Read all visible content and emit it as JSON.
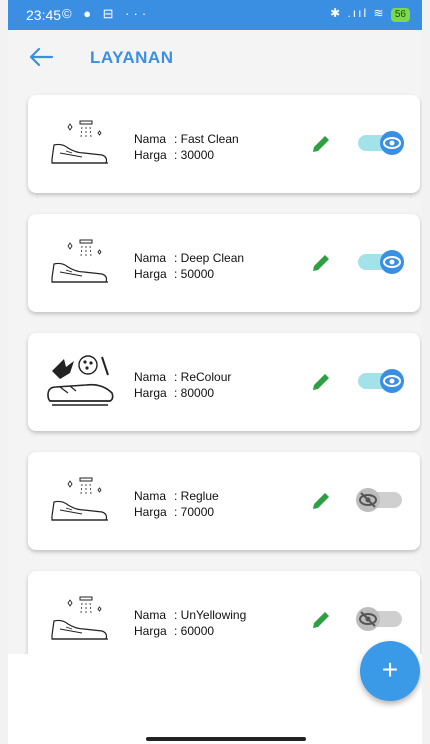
{
  "status_bar": {
    "time": "23:45",
    "left_icons": "© ● ⊟ ···",
    "right_icons": "✱ .ııl ≋",
    "battery": "56"
  },
  "header": {
    "title": "LAYANAN"
  },
  "labels": {
    "name": "Nama",
    "price": "Harga"
  },
  "services": [
    {
      "name": "Fast Clean",
      "price": "30000",
      "visible": true,
      "icon": "shoe-cleaning-icon"
    },
    {
      "name": "Deep Clean",
      "price": "50000",
      "visible": true,
      "icon": "shoe-cleaning-icon"
    },
    {
      "name": "ReColour",
      "price": "80000",
      "visible": true,
      "icon": "shoe-painting-icon"
    },
    {
      "name": "Reglue",
      "price": "70000",
      "visible": false,
      "icon": "shoe-cleaning-icon"
    },
    {
      "name": "UnYellowing",
      "price": "60000",
      "visible": false,
      "icon": "shoe-cleaning-icon"
    }
  ],
  "fab": {
    "label": "+"
  },
  "colors": {
    "primary": "#3a8fe3",
    "edit_green": "#2ea043",
    "toggle_on_track": "#a4e2ea",
    "toggle_off_track": "#cfcfcf"
  }
}
